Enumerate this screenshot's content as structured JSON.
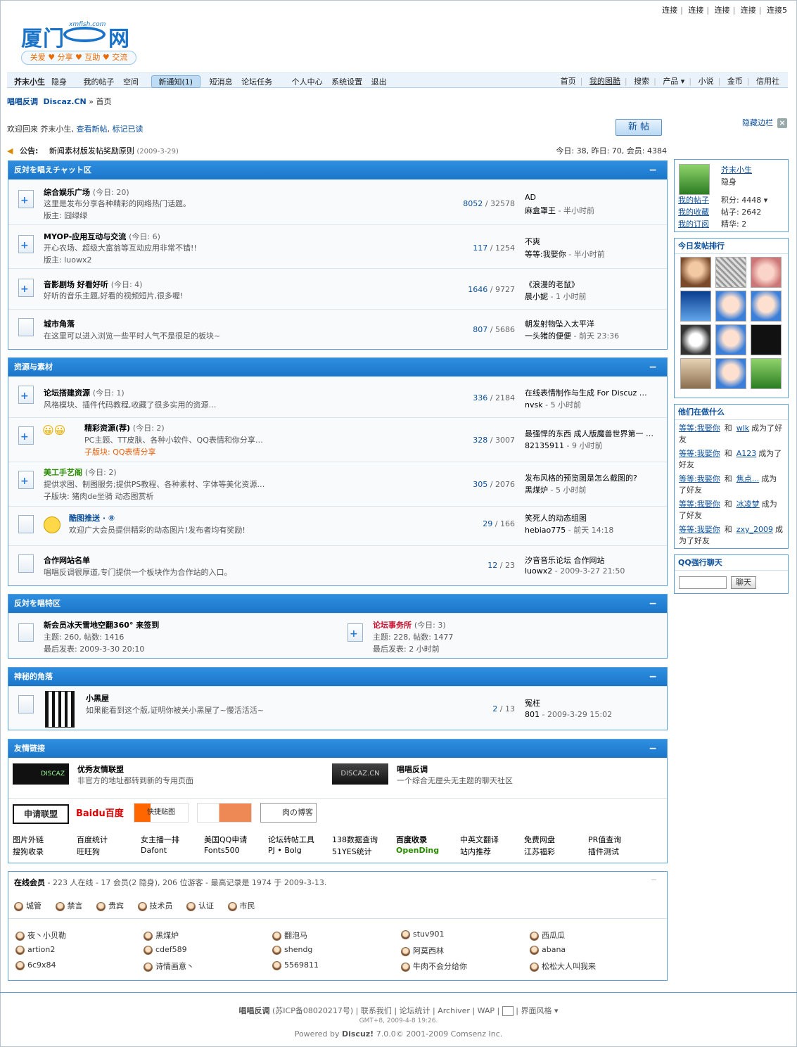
{
  "top_links": [
    "连接",
    "连接",
    "连接",
    "连接",
    "连接5"
  ],
  "logo": {
    "title": "厦门",
    "title2": "网",
    "url": "xmfish.com",
    "slogan": "关爱 ♥ 分享 ♥ 互助 ♥ 交流"
  },
  "nav": {
    "user": "芥末小生",
    "status": "隐身",
    "my_posts": "我的帖子",
    "space": "空间",
    "notice": "新通知(1)",
    "pm": "短消息",
    "tasks": "论坛任务",
    "center": "个人中心",
    "settings": "系统设置",
    "logout": "退出",
    "right": [
      "首页",
      "我的图酷",
      "搜索",
      "产品 ▾",
      "小说",
      "金币",
      "信用社"
    ]
  },
  "breadcrumb": {
    "site": "唱唱反调",
    "discaz": "Discaz.CN",
    "sep": "»",
    "home": "首页"
  },
  "welcome": {
    "text": "欢迎回来 芥末小生,",
    "new": "查看新帖",
    "mark": "标记已读"
  },
  "newpost_label": "新 帖",
  "hide_sidebar": "隐藏边栏",
  "announce": {
    "label": "公告:",
    "title": "新闻素材版发帖奖励原则",
    "date": "(2009-3-29)",
    "stats": "今日: 38, 昨日: 70, 会员: 4384"
  },
  "sections": [
    {
      "title": "反対を唱えチャット区",
      "forums": [
        {
          "name": "综合娱乐广场",
          "today": "(今日: 20)",
          "desc": "这里是发布分享各种精彩的网络热门话题。",
          "mod": "版主: 囧绿绿",
          "topics": "8052",
          "posts": "32578",
          "last_title": "AD",
          "last_by": "麻盒罩王",
          "last_time": "半小时前"
        },
        {
          "name": "MYOP-应用互动与交流",
          "today": "(今日: 6)",
          "desc": "开心农场、超级大富翁等互动应用非常不错!!",
          "mod": "版主: luowx2",
          "topics": "117",
          "posts": "1254",
          "last_title": "不爽",
          "last_by": "等等:我娶你",
          "last_time": "半小时前"
        },
        {
          "name": "音影剧场 好看好听",
          "today": "(今日: 4)",
          "desc": "好听的音乐主题,好看的视频短片,很多喔!",
          "mod": "",
          "topics": "1646",
          "posts": "9727",
          "last_title": "《浪漫的老鼠》",
          "last_by": "晨小妮",
          "last_time": "1 小时前"
        },
        {
          "name": "城市角落",
          "today": "",
          "desc": "在这里可以进入浏览一些平时人气不是很足的板块~",
          "mod": "",
          "topics": "807",
          "posts": "5686",
          "last_title": "朝发射物坠入太平洋",
          "last_by": "一头猪的便便",
          "last_time": "前天 23:36"
        }
      ]
    },
    {
      "title": "资源与素材",
      "forums": [
        {
          "name": "论坛搭建资源",
          "today": "(今日: 1)",
          "desc": "风格模块、插件代码教程,收藏了很多实用的资源…",
          "mod": "",
          "topics": "336",
          "posts": "2184",
          "last_title": "在线表情制作与生成 For Discuz …",
          "last_by": "nvsk",
          "last_time": "5 小时前"
        },
        {
          "name": "精彩资源(荐)",
          "today": "(今日: 2)",
          "desc": "PC主题、TT皮肤、各种小软件、QQ表情和你分享…",
          "mod": "子版块: QQ表情分享",
          "topics": "328",
          "posts": "3007",
          "last_title": "最强悍的东西 成人版魔兽世界第一 …",
          "last_by": "82135911",
          "last_time": "9 小时前"
        },
        {
          "name": "美工手艺阁",
          "today": "(今日: 2)",
          "desc": "提供求图、制图服务;提供PS教程、各种素材、字体等美化资源…",
          "mod": "子版块: 猪肉de坐骑 动态图赏析",
          "topics": "305",
          "posts": "2076",
          "last_title": "发布风格的预览图是怎么截图的?",
          "last_by": "黑煤炉",
          "last_time": "5 小时前"
        },
        {
          "name": "酷图推送 · ⑧",
          "today": "",
          "desc": "欢迎广大会员提供精彩的动态图片!发布者均有奖励!",
          "mod": "",
          "topics": "29",
          "posts": "166",
          "last_title": "笑死人的动态组图",
          "last_by": "hebiao775",
          "last_time": "前天 14:18"
        },
        {
          "name": "合作网站名单",
          "today": "",
          "desc": "唱唱反调很厚道,专门提供一个板块作为合作站的入口。",
          "mod": "",
          "topics": "12",
          "posts": "23",
          "last_title": "汐音音乐论坛 合作网站",
          "last_by": "luowx2",
          "last_time": "2009-3-27 21:50"
        }
      ]
    }
  ],
  "special": {
    "title": "反対を唱特区",
    "left": {
      "name": "新会员冰天雪地空翻360° 来签到",
      "stats": "主题: 260, 帖数: 1416",
      "last": "最后发表: 2009-3-30 20:10"
    },
    "right": {
      "name": "论坛事务所",
      "today": "(今日: 3)",
      "stats": "主题: 228, 帖数: 1477",
      "last": "最后发表: 2 小时前"
    }
  },
  "secret": {
    "title": "神秘的角落",
    "name": "小黑屋",
    "desc": "如果能看到这个版,证明你被关小黑屋了~慢活活活~",
    "topics": "2",
    "posts": "13",
    "last_title": "冤枉",
    "last_by": "801",
    "last_time": "2009-3-29 15:02"
  },
  "links": {
    "title": "友情链接",
    "a": {
      "name": "优秀友情联盟",
      "desc": "非官方的地址都转到新的专用页面",
      "logo": "DISCAZ"
    },
    "b": {
      "name": "唱唱反调",
      "desc": "一个综合无厘头无主题的聊天社区",
      "logo": "DISCAZ.CN"
    },
    "logos": [
      "申请联盟",
      "Baidu百度",
      "快捷贴图",
      "",
      "肉の博客"
    ],
    "grid": [
      [
        "图片外链",
        "搜狗收录"
      ],
      [
        "百度统计",
        "旺旺狗"
      ],
      [
        "女主播一排",
        "Dafont"
      ],
      [
        "美国QQ申请",
        "Fonts500"
      ],
      [
        "论坛转帖工具",
        "PJ • Bolg"
      ],
      [
        "138数据查询",
        "51YES统计"
      ],
      [
        "百度收录",
        "OpenDing"
      ],
      [
        "中英文翻译",
        "站内推荐"
      ],
      [
        "免费网盘",
        "江苏福彩"
      ],
      [
        "PR值查询",
        "插件测试"
      ]
    ]
  },
  "online": {
    "title": "在线会员",
    "summary": "- 223 人在线 - 17 会员(2 隐身), 206 位游客 - 最高记录是 1974 于 2009-3-13.",
    "roles": [
      "城管",
      "禁言",
      "贵宾",
      "技术员",
      "认证",
      "市民"
    ],
    "users": [
      "夜丶小贝勒",
      "黑煤炉",
      "翻泡马",
      "stuv901",
      "西瓜瓜",
      "artion2",
      "cdef589",
      "shendg",
      "阿莫西林",
      "abana",
      "6c9x84",
      "诗情画意丶",
      "5569811",
      "牛肉不会分给你",
      "松松大人叫我来"
    ]
  },
  "sidebar": {
    "user": "芥末小生",
    "status": "隐身",
    "links": [
      "我的帖子",
      "我的收藏",
      "我的订阅"
    ],
    "stats": [
      "积分: 4448 ▾",
      "帖子: 2642",
      "精华: 2"
    ],
    "rank_title": "今日发帖排行",
    "doing_title": "他们在做什么",
    "doing": [
      {
        "a": "等等:我娶你",
        "and": "和",
        "b": "wlk",
        "t": "成为了好友"
      },
      {
        "a": "等等:我娶你",
        "and": "和",
        "b": "A123",
        "t": "成为了好友"
      },
      {
        "a": "等等:我娶你",
        "and": "和",
        "b": "焦点...",
        "t": "成为了好友"
      },
      {
        "a": "等等:我娶你",
        "and": "和",
        "b": "冰凌梦",
        "t": "成为了好友"
      },
      {
        "a": "等等:我娶你",
        "and": "和",
        "b": "zxy_2009",
        "t": "成为了好友"
      }
    ],
    "qq_title": "QQ强行聊天",
    "qq_btn": "聊天"
  },
  "footer": {
    "site": "唱唱反调",
    "icp": "(苏ICP备08020217号)",
    "contact": "联系我们",
    "stats": "论坛统计",
    "archiver": "Archiver",
    "wap": "WAP",
    "style": "界面风格 ▾",
    "time": "GMT+8, 2009-4-8 19:26.",
    "powered": "Powered by",
    "discuz": "Discuz!",
    "ver": "7.0.0© 2001-2009 Comsenz Inc."
  }
}
